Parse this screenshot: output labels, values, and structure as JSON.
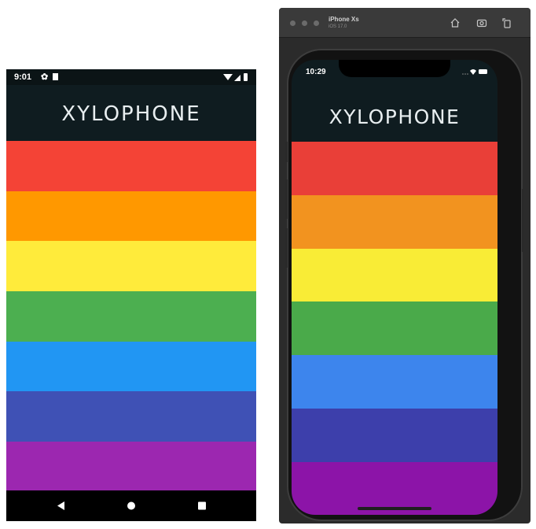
{
  "android": {
    "status_time": "9:01",
    "status_icons": [
      "gear-icon",
      "sd-card-icon",
      "wifi-icon",
      "signal-icon",
      "battery-icon"
    ],
    "title": "XYLOPHONE",
    "bar_colors": [
      "#f44336",
      "#ff9800",
      "#ffeb3b",
      "#4caf50",
      "#2196f3",
      "#3f51b5",
      "#9c27b0"
    ],
    "nav": [
      "back-icon",
      "home-icon",
      "recents-icon"
    ]
  },
  "simulator": {
    "device_name": "iPhone Xs",
    "os_version": "iOS 17.0",
    "toolbar_icons": [
      "home-icon",
      "screenshot-icon",
      "rotate-icon"
    ],
    "status_time": "10:29",
    "title": "XYLOPHONE",
    "bar_colors": [
      "#e93f38",
      "#f2931f",
      "#f9ec36",
      "#4aaa4a",
      "#3d85ed",
      "#3d3fab",
      "#8c14a8"
    ]
  }
}
